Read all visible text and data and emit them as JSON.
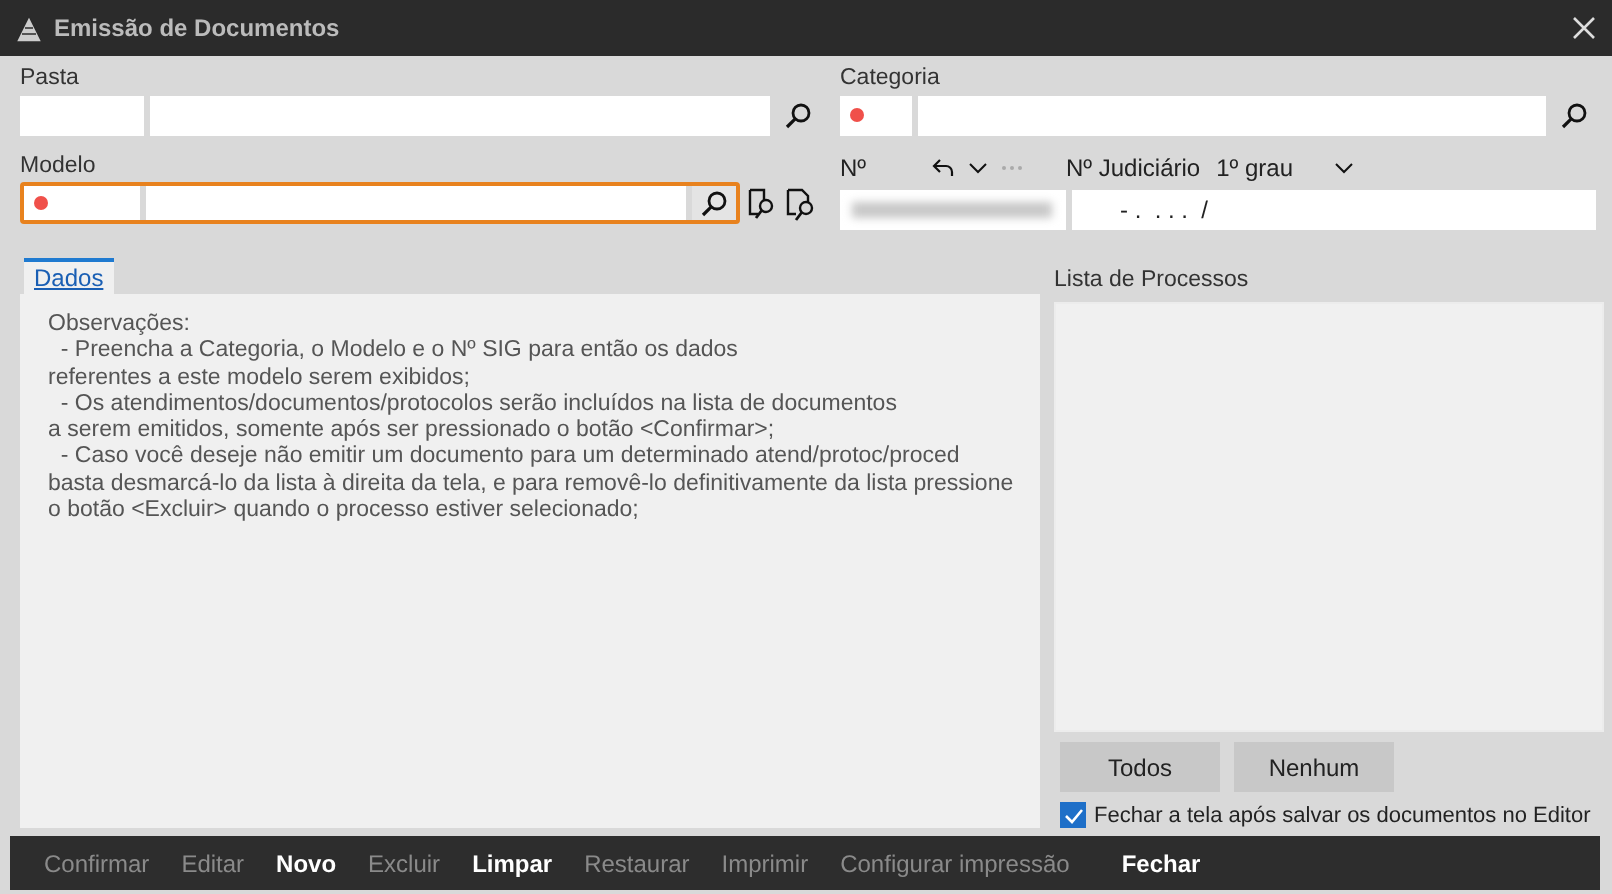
{
  "window": {
    "title": "Emissão de Documentos"
  },
  "pasta": {
    "label": "Pasta",
    "required": false
  },
  "categoria": {
    "label": "Categoria",
    "required": true
  },
  "modelo": {
    "label": "Modelo",
    "required": true,
    "focused": true
  },
  "numero": {
    "label": "Nº",
    "blurred": true
  },
  "judiciario": {
    "label": "Nº Judiciário",
    "instance": "1º grau",
    "value": "- .  . . .  /"
  },
  "tabs": [
    {
      "label": "Dados",
      "selected": true
    }
  ],
  "observacoes": "Observações:\n  - Preencha a Categoria, o Modelo e o Nº SIG para então os dados\nreferentes a este modelo serem exibidos;\n  - Os atendimentos/documentos/protocolos serão incluídos na lista de documentos\na serem emitidos, somente após ser pressionado o botão <Confirmar>;\n  - Caso você deseje não emitir um documento para um determinado atend/protoc/proced\nbasta desmarcá-lo da lista à direita da tela, e para removê-lo definitivamente da lista pressione\no botão <Excluir> quando o processo estiver selecionado;",
  "lista": {
    "label": "Lista de Processos",
    "buttons": [
      "Todos",
      "Nenhum"
    ]
  },
  "close_option": {
    "label": "Fechar a tela após salvar os documentos no Editor",
    "checked": true
  },
  "toolbar": [
    {
      "label": "Confirmar",
      "disabled": true
    },
    {
      "label": "Editar",
      "disabled": true
    },
    {
      "label": "Novo",
      "disabled": false
    },
    {
      "label": "Excluir",
      "disabled": true
    },
    {
      "label": "Limpar",
      "disabled": false
    },
    {
      "label": "Restaurar",
      "disabled": true
    },
    {
      "label": "Imprimir",
      "disabled": true
    },
    {
      "label": "Configurar impressão",
      "disabled": true
    },
    {
      "label": "Fechar",
      "disabled": false
    }
  ]
}
